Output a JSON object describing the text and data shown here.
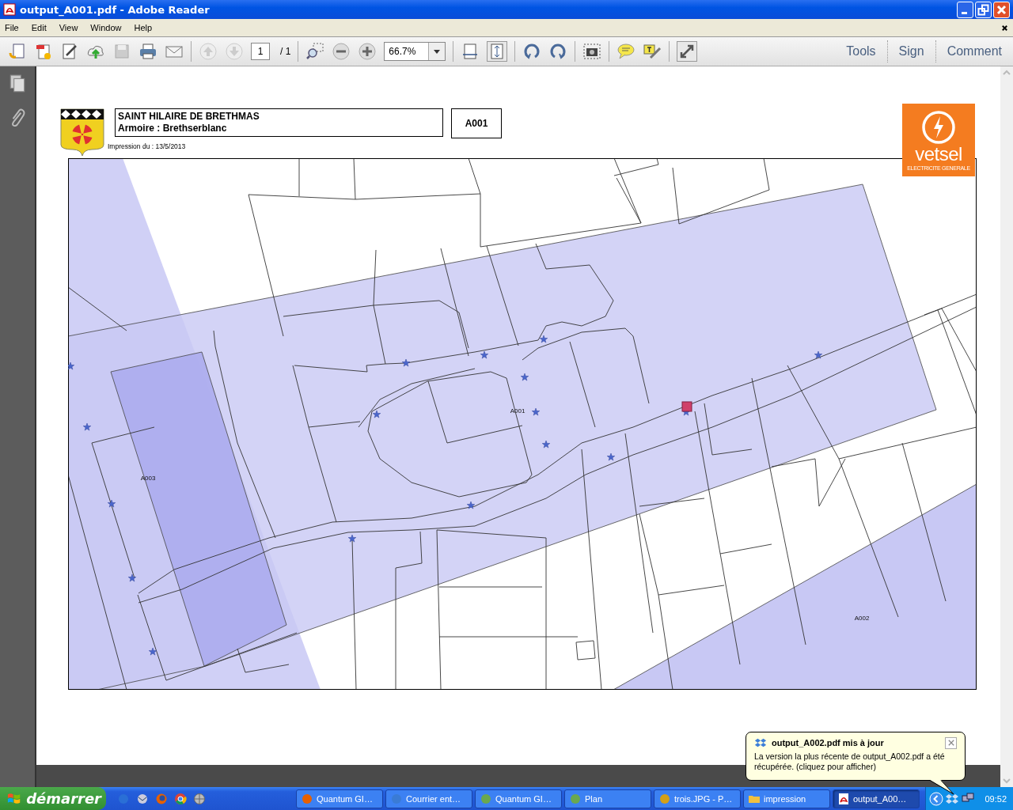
{
  "window": {
    "title": "output_A001.pdf - Adobe Reader"
  },
  "menu": [
    "File",
    "Edit",
    "View",
    "Window",
    "Help"
  ],
  "toolbar": {
    "page": "1",
    "page_total": "/ 1",
    "zoom": "66.7%",
    "panels": [
      {
        "label": "Tools"
      },
      {
        "label": "Sign"
      },
      {
        "label": "Comment"
      }
    ]
  },
  "document": {
    "title": "SAINT HILAIRE DE BRETHMAS",
    "subtitle": "Armoire : Brethserblanc",
    "code": "A001",
    "print_date": "Impression du : 13/5/2013",
    "logo_name": "vetsel",
    "logo_tagline": "ELECTRICITE GENERALE",
    "map_labels": [
      {
        "text": "A001"
      },
      {
        "text": "A002"
      },
      {
        "text": "A003"
      }
    ]
  },
  "notification": {
    "title": "output_A002.pdf mis à jour",
    "body": "La version la plus récente de output_A002.pdf a été récupérée. (cliquez pour afficher)"
  },
  "taskbar": {
    "start": "démarrer",
    "tasks": [
      {
        "label": "Quantum GI…",
        "kind": "firefox",
        "selected": false
      },
      {
        "label": "Courrier ent…",
        "kind": "mail",
        "selected": false
      },
      {
        "label": "Quantum GI…",
        "kind": "qgis",
        "selected": false
      },
      {
        "label": "Plan",
        "kind": "qgis",
        "selected": false
      },
      {
        "label": "trois.JPG - P…",
        "kind": "paint",
        "selected": false
      },
      {
        "label": "impression",
        "kind": "folder",
        "selected": false
      },
      {
        "label": "output_A00…",
        "kind": "pdf",
        "selected": true
      }
    ],
    "clock": "09:52"
  }
}
